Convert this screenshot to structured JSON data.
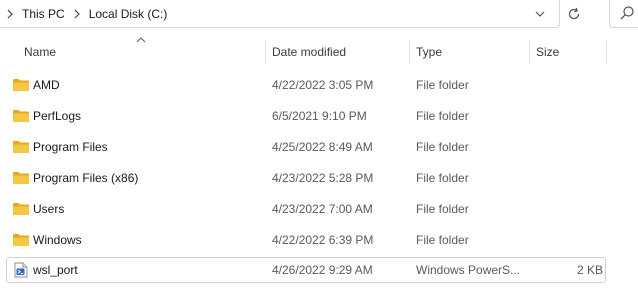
{
  "breadcrumb": {
    "items": [
      "This PC",
      "Local Disk (C:)"
    ]
  },
  "columns": {
    "name": "Name",
    "date": "Date modified",
    "type": "Type",
    "size": "Size"
  },
  "rows": [
    {
      "name": "AMD",
      "date": "4/22/2022 3:05 PM",
      "type": "File folder",
      "size": "",
      "icon": "folder-icon"
    },
    {
      "name": "PerfLogs",
      "date": "6/5/2021 9:10 PM",
      "type": "File folder",
      "size": "",
      "icon": "folder-icon"
    },
    {
      "name": "Program Files",
      "date": "4/25/2022 8:49 AM",
      "type": "File folder",
      "size": "",
      "icon": "folder-icon"
    },
    {
      "name": "Program Files (x86)",
      "date": "4/23/2022 5:28 PM",
      "type": "File folder",
      "size": "",
      "icon": "folder-icon"
    },
    {
      "name": "Users",
      "date": "4/23/2022 7:00 AM",
      "type": "File folder",
      "size": "",
      "icon": "folder-icon"
    },
    {
      "name": "Windows",
      "date": "4/22/2022 6:39 PM",
      "type": "File folder",
      "size": "",
      "icon": "folder-icon"
    },
    {
      "name": "wsl_port",
      "date": "4/26/2022 9:29 AM",
      "type": "Windows PowerS...",
      "size": "2 KB",
      "icon": "powershell-script-icon"
    }
  ],
  "selected_row": "wsl_port",
  "colors": {
    "folder": "#f6c645",
    "folder_dark": "#e8a820",
    "accent": "#0067c0"
  }
}
